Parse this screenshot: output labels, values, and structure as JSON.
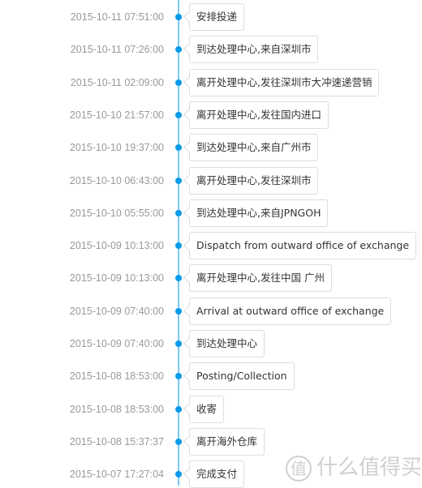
{
  "timeline": [
    {
      "time": "2015-10-11 07:51:00",
      "event": "安排投递"
    },
    {
      "time": "2015-10-11 07:26:00",
      "event": "到达处理中心,来自深圳市"
    },
    {
      "time": "2015-10-11 02:09:00",
      "event": "离开处理中心,发往深圳市大冲速递营销"
    },
    {
      "time": "2015-10-10 21:57:00",
      "event": "离开处理中心,发往国内进口"
    },
    {
      "time": "2015-10-10 19:37:00",
      "event": "到达处理中心,来自广州市"
    },
    {
      "time": "2015-10-10 06:43:00",
      "event": "离开处理中心,发往深圳市"
    },
    {
      "time": "2015-10-10 05:55:00",
      "event": "到达处理中心,来自JPNGOH"
    },
    {
      "time": "2015-10-09 10:13:00",
      "event": "Dispatch from outward office of exchange"
    },
    {
      "time": "2015-10-09 10:13:00",
      "event": "离开处理中心,发往中国 广州"
    },
    {
      "time": "2015-10-09 07:40:00",
      "event": "Arrival at outward office of exchange"
    },
    {
      "time": "2015-10-09 07:40:00",
      "event": "到达处理中心"
    },
    {
      "time": "2015-10-08 18:53:00",
      "event": "Posting/Collection"
    },
    {
      "time": "2015-10-08 18:53:00",
      "event": "收寄"
    },
    {
      "time": "2015-10-08 15:37:37",
      "event": "离开海外仓库"
    },
    {
      "time": "2015-10-07 17:27:04",
      "event": "完成支付"
    }
  ],
  "watermark": {
    "icon": "值",
    "text": "什么值得买"
  },
  "colors": {
    "accent": "#0a9be8",
    "line": "#7cc7f2"
  }
}
